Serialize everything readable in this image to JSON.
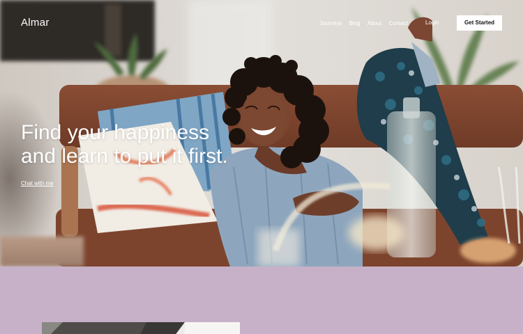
{
  "brand": {
    "name": "Almar"
  },
  "nav": {
    "links": [
      {
        "label": "Journeys"
      },
      {
        "label": "Blog"
      },
      {
        "label": "About"
      },
      {
        "label": "Contact"
      }
    ],
    "login_label": "Login",
    "cta_label": "Get Started"
  },
  "hero": {
    "headline_line1": "Find your happiness",
    "headline_line2": "and learn to put it first.",
    "link_label": "Chat with me"
  },
  "colors": {
    "section_background": "#c7b1c8",
    "cta_background": "#ffffff",
    "text_on_hero": "#ffffff"
  },
  "icons": []
}
